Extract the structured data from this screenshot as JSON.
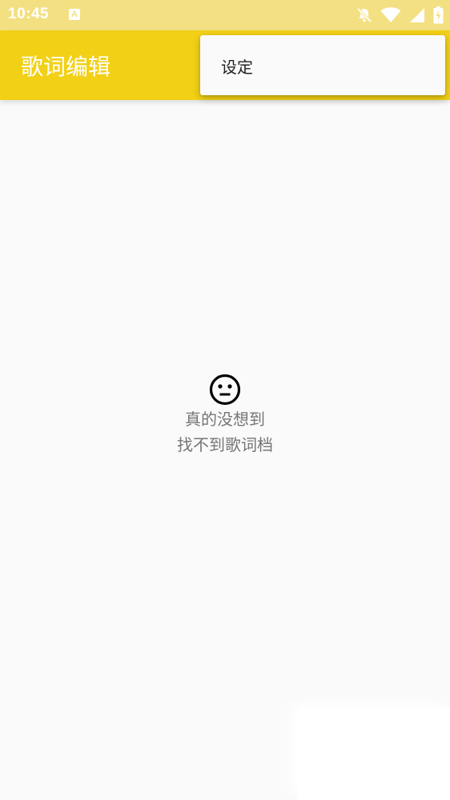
{
  "status_bar": {
    "time": "10:45",
    "notification_icon_letter": "A",
    "icons": [
      "alarm-off-icon",
      "wifi-icon",
      "signal-icon",
      "battery-charging-icon"
    ]
  },
  "app_bar": {
    "title": "歌词编辑",
    "background_color": "#f2d016"
  },
  "overflow_menu": {
    "items": [
      {
        "label": "设定"
      }
    ]
  },
  "empty_state": {
    "icon": "neutral-face-icon",
    "line1": "真的没想到",
    "line2": "找不到歌词档"
  }
}
